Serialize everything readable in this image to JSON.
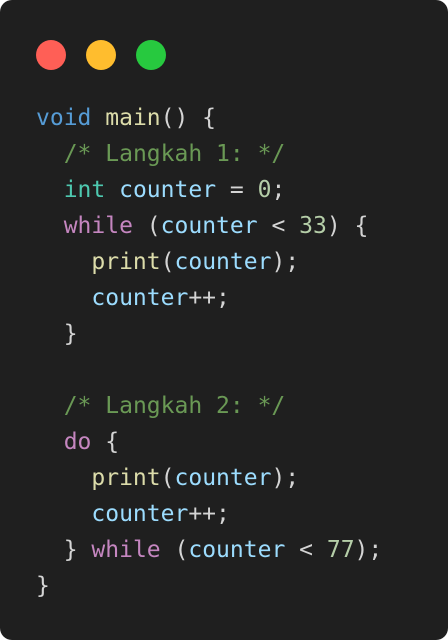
{
  "window": {
    "controls": {
      "close_color": "#ff5f56",
      "minimize_color": "#ffbd2e",
      "maximize_color": "#27c93f"
    }
  },
  "code": {
    "lines": [
      {
        "indent": "",
        "tokens": [
          {
            "t": "void",
            "c": "kw"
          },
          {
            "t": " ",
            "c": "pun"
          },
          {
            "t": "main",
            "c": "fn"
          },
          {
            "t": "() {",
            "c": "pun"
          }
        ]
      },
      {
        "indent": "  ",
        "tokens": [
          {
            "t": "/* Langkah 1: */",
            "c": "cm"
          }
        ]
      },
      {
        "indent": "  ",
        "tokens": [
          {
            "t": "int",
            "c": "ty"
          },
          {
            "t": " ",
            "c": "pun"
          },
          {
            "t": "counter",
            "c": "var"
          },
          {
            "t": " = ",
            "c": "pun"
          },
          {
            "t": "0",
            "c": "num"
          },
          {
            "t": ";",
            "c": "pun"
          }
        ]
      },
      {
        "indent": "  ",
        "tokens": [
          {
            "t": "while",
            "c": "ctl"
          },
          {
            "t": " (",
            "c": "pun"
          },
          {
            "t": "counter",
            "c": "var"
          },
          {
            "t": " < ",
            "c": "pun"
          },
          {
            "t": "33",
            "c": "num"
          },
          {
            "t": ") {",
            "c": "pun"
          }
        ]
      },
      {
        "indent": "    ",
        "tokens": [
          {
            "t": "print",
            "c": "fn"
          },
          {
            "t": "(",
            "c": "pun"
          },
          {
            "t": "counter",
            "c": "var"
          },
          {
            "t": ");",
            "c": "pun"
          }
        ]
      },
      {
        "indent": "    ",
        "tokens": [
          {
            "t": "counter",
            "c": "var"
          },
          {
            "t": "++;",
            "c": "pun"
          }
        ]
      },
      {
        "indent": "  ",
        "tokens": [
          {
            "t": "}",
            "c": "pun"
          }
        ]
      },
      {
        "indent": "",
        "tokens": []
      },
      {
        "indent": "  ",
        "tokens": [
          {
            "t": "/* Langkah 2: */",
            "c": "cm"
          }
        ]
      },
      {
        "indent": "  ",
        "tokens": [
          {
            "t": "do",
            "c": "ctl"
          },
          {
            "t": " {",
            "c": "pun"
          }
        ]
      },
      {
        "indent": "    ",
        "tokens": [
          {
            "t": "print",
            "c": "fn"
          },
          {
            "t": "(",
            "c": "pun"
          },
          {
            "t": "counter",
            "c": "var"
          },
          {
            "t": ");",
            "c": "pun"
          }
        ]
      },
      {
        "indent": "    ",
        "tokens": [
          {
            "t": "counter",
            "c": "var"
          },
          {
            "t": "++;",
            "c": "pun"
          }
        ]
      },
      {
        "indent": "  ",
        "tokens": [
          {
            "t": "} ",
            "c": "pun"
          },
          {
            "t": "while",
            "c": "ctl"
          },
          {
            "t": " (",
            "c": "pun"
          },
          {
            "t": "counter",
            "c": "var"
          },
          {
            "t": " < ",
            "c": "pun"
          },
          {
            "t": "77",
            "c": "num"
          },
          {
            "t": ");",
            "c": "pun"
          }
        ]
      },
      {
        "indent": "",
        "tokens": [
          {
            "t": "}",
            "c": "pun"
          }
        ]
      }
    ]
  }
}
